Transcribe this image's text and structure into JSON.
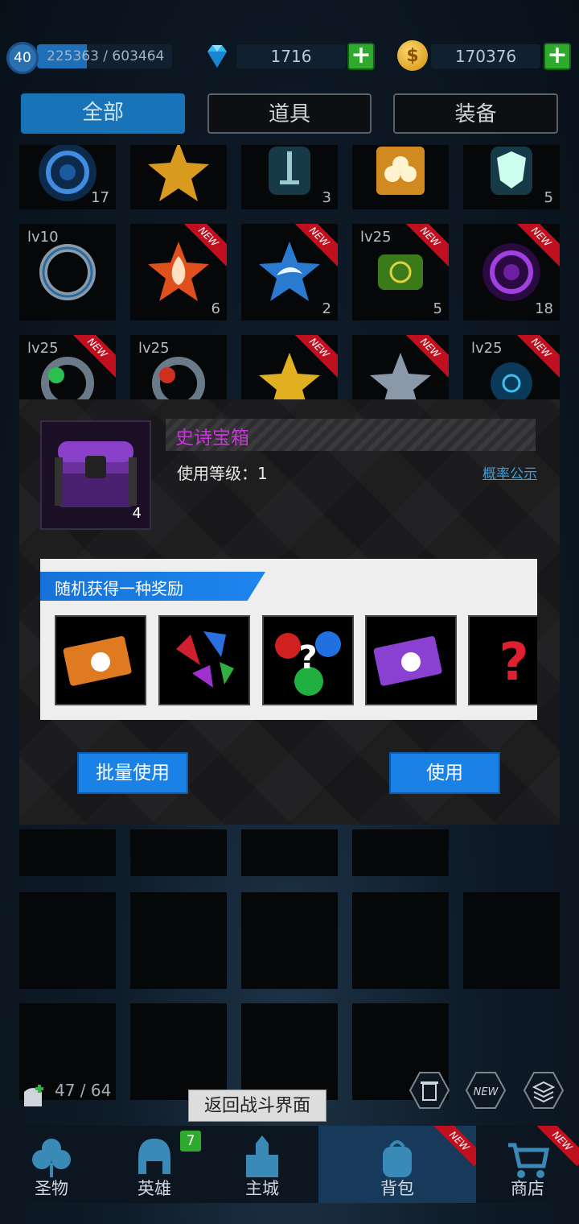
{
  "topbar": {
    "level": "40",
    "xp_text": "225363 / 603464",
    "xp_progress": 0.37,
    "gems": "1716",
    "coins": "170376"
  },
  "tabs": [
    {
      "label": "全部",
      "active": true
    },
    {
      "label": "道具",
      "active": false
    },
    {
      "label": "装备",
      "active": false
    }
  ],
  "grid": {
    "row1": [
      {
        "icon": "blue-vortex-icon",
        "count": "17"
      },
      {
        "icon": "gold-star-icon",
        "count": ""
      },
      {
        "icon": "sword-rune-icon",
        "count": "3"
      },
      {
        "icon": "clover-puzzle-icon",
        "count": ""
      },
      {
        "icon": "shield-rune-icon",
        "count": "5"
      }
    ],
    "row2": [
      {
        "icon": "dragon-ring-icon",
        "lv": "lv10",
        "count": "",
        "new": false
      },
      {
        "icon": "fire-star-icon",
        "lv": "",
        "count": "6",
        "new": true
      },
      {
        "icon": "wave-star-icon",
        "lv": "",
        "count": "2",
        "new": true
      },
      {
        "icon": "scroll-icon",
        "lv": "lv25",
        "count": "5",
        "new": true
      },
      {
        "icon": "purple-vortex-icon",
        "lv": "",
        "count": "18",
        "new": true
      }
    ],
    "row3": [
      {
        "icon": "green-ring-icon",
        "lv": "lv25",
        "new": true
      },
      {
        "icon": "red-ring-icon",
        "lv": "lv25",
        "new": false
      },
      {
        "icon": "gold-star-icon",
        "lv": "",
        "new": true
      },
      {
        "icon": "silver-star-icon",
        "lv": "",
        "new": true
      },
      {
        "icon": "blue-relic-icon",
        "lv": "lv25",
        "new": true
      }
    ],
    "new_label": "NEW"
  },
  "modal": {
    "item_name": "史诗宝箱",
    "item_count": "4",
    "level_text": "使用等级：1",
    "prob_link": "概率公示",
    "reward_title": "随机获得一种奖励",
    "rewards": [
      "orange-ticket-icon",
      "gem-pile-icon",
      "mystery-gems-icon",
      "purple-ticket-icon",
      "question-icon"
    ],
    "batch_use": "批量使用",
    "use": "使用"
  },
  "bag": {
    "count_text": "47 / 64"
  },
  "tooltip": "返回战斗界面",
  "nav": [
    {
      "label": "圣物"
    },
    {
      "label": "英雄",
      "badge": "7"
    },
    {
      "label": "主城"
    },
    {
      "label": "背包",
      "new": true
    },
    {
      "label": "商店",
      "new": true
    }
  ],
  "colors": {
    "accent": "#1873b8",
    "epic": "#cc33dd",
    "new_tag": "#c01020",
    "plus": "#2faa2f"
  }
}
